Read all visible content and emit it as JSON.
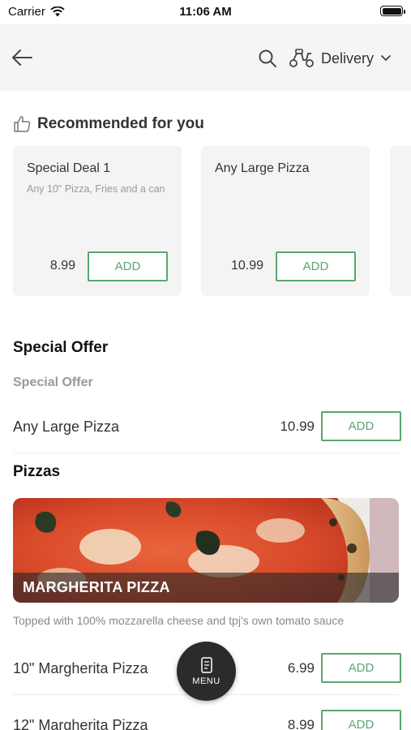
{
  "status_bar": {
    "carrier": "Carrier",
    "time": "11:06 AM",
    "battery_level": 1.0
  },
  "header": {
    "delivery_label": "Delivery"
  },
  "recommended": {
    "title": "Recommended for you",
    "cards": [
      {
        "name": "Special Deal 1",
        "description": "Any 10\" Pizza, Fries and a can",
        "price": "8.99",
        "add_label": "ADD"
      },
      {
        "name": "Any Large Pizza",
        "description": "",
        "price": "10.99",
        "add_label": "ADD"
      }
    ]
  },
  "special_offer": {
    "title": "Special Offer",
    "subtitle": "Special Offer",
    "items": [
      {
        "name": "Any Large Pizza",
        "price": "10.99",
        "add_label": "ADD"
      }
    ]
  },
  "pizzas": {
    "title": "Pizzas",
    "banner_title": "MARGHERITA PIZZA",
    "banner_description": "Topped with 100% mozzarella cheese and tpj's own tomato sauce",
    "items": [
      {
        "name": "10\" Margherita Pizza",
        "price": "6.99",
        "add_label": "ADD"
      },
      {
        "name": "12\" Margherita Pizza",
        "price": "8.99",
        "add_label": "ADD"
      }
    ]
  },
  "menu_button": {
    "label": "MENU"
  },
  "colors": {
    "accent": "#5aa670",
    "header_bg": "#f5f5f5",
    "card_bg": "#f4f4f4",
    "fab_bg": "#2b2b2b"
  }
}
